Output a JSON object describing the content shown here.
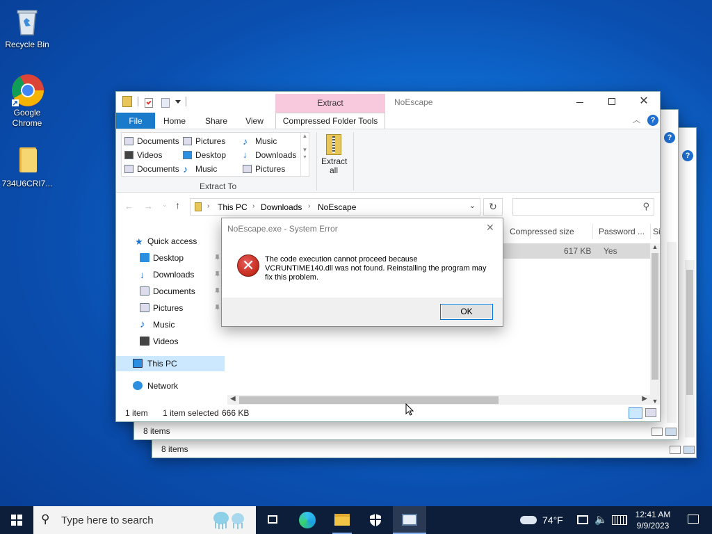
{
  "desktop": {
    "icons": [
      {
        "label": "Recycle Bin"
      },
      {
        "label": "Google Chrome"
      },
      {
        "label": "734U6CRI7..."
      }
    ]
  },
  "back_windows": [
    {
      "status": "8 items"
    },
    {
      "status": "8 items"
    }
  ],
  "explorer": {
    "title": "NoEscape",
    "contextual_tab": "Extract",
    "tabs": {
      "file": "File",
      "home": "Home",
      "share": "Share",
      "view": "View",
      "tools": "Compressed Folder Tools"
    },
    "gallery": [
      [
        "Documents",
        "Pictures",
        "Music"
      ],
      [
        "Videos",
        "Desktop",
        "Downloads"
      ],
      [
        "Documents",
        "Music",
        "Pictures"
      ]
    ],
    "extract_to_label": "Extract To",
    "extract_all": "Extract all",
    "breadcrumb": [
      "This PC",
      "Downloads",
      "NoEscape"
    ],
    "search_placeholder": "",
    "columns": [
      "Compressed size",
      "Password ...",
      "Si"
    ],
    "row": {
      "compressed": "617 KB",
      "password": "Yes"
    },
    "nav": {
      "quick": "Quick access",
      "desktop": "Desktop",
      "downloads": "Downloads",
      "documents": "Documents",
      "pictures": "Pictures",
      "music": "Music",
      "videos": "Videos",
      "this_pc": "This PC",
      "network": "Network"
    },
    "status": {
      "count": "1 item",
      "selected": "1 item selected",
      "size": "666 KB"
    }
  },
  "dialog": {
    "title": "NoEscape.exe - System Error",
    "message": "The code execution cannot proceed because VCRUNTIME140.dll was not found. Reinstalling the program may fix this problem.",
    "ok": "OK"
  },
  "taskbar": {
    "search_placeholder": "Type here to search",
    "weather": "74°F",
    "time": "12:41 AM",
    "date": "9/9/2023"
  },
  "colors": {
    "accent": "#0078d7",
    "contextual_tab": "#f8c8dc",
    "error": "#c42b1c"
  }
}
